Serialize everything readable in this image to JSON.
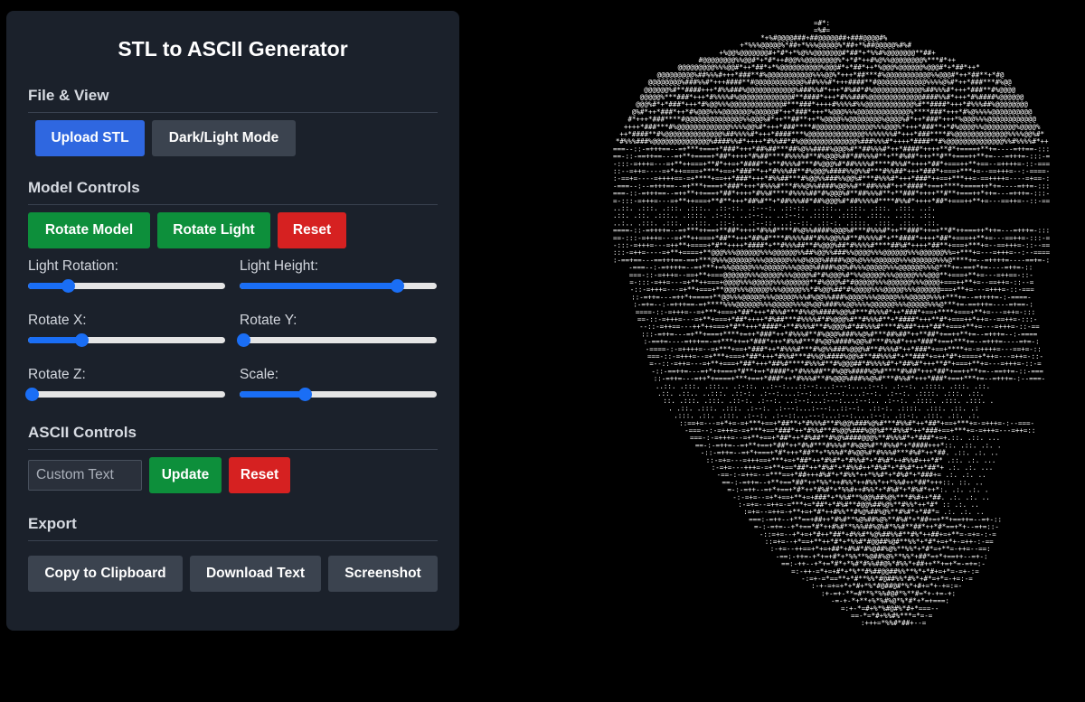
{
  "panel": {
    "title": "STL to ASCII Generator",
    "sections": {
      "file_view": "File & View",
      "model_controls": "Model Controls",
      "ascii_controls": "ASCII Controls",
      "export": "Export"
    },
    "buttons": {
      "upload_stl": "Upload STL",
      "dark_light_mode": "Dark/Light Mode",
      "rotate_model": "Rotate Model",
      "rotate_light": "Rotate Light",
      "reset_model": "Reset",
      "update": "Update",
      "reset_ascii": "Reset",
      "copy_clipboard": "Copy to Clipboard",
      "download_text": "Download Text",
      "screenshot": "Screenshot"
    },
    "sliders": [
      {
        "label": "Light Rotation:",
        "value": 0.2
      },
      {
        "label": "Light Height:",
        "value": 0.8
      },
      {
        "label": "Rotate X:",
        "value": 0.27
      },
      {
        "label": "Rotate Y:",
        "value": 0.02
      },
      {
        "label": "Rotate Z:",
        "value": 0.02
      },
      {
        "label": "Scale:",
        "value": 0.33
      }
    ],
    "custom_text": {
      "placeholder": "Custom Text",
      "value": ""
    }
  },
  "ascii_output": {
    "charset": " .:-=+*#%@",
    "colors": {
      "background": "#000000",
      "foreground": "#ffffff"
    }
  },
  "colors": {
    "panel_bg": "#1b212b",
    "blue": "#2f67e0",
    "green": "#0d8f3b",
    "red": "#d62121",
    "gray": "#3b434f",
    "slider": "#1a6ef5"
  }
}
